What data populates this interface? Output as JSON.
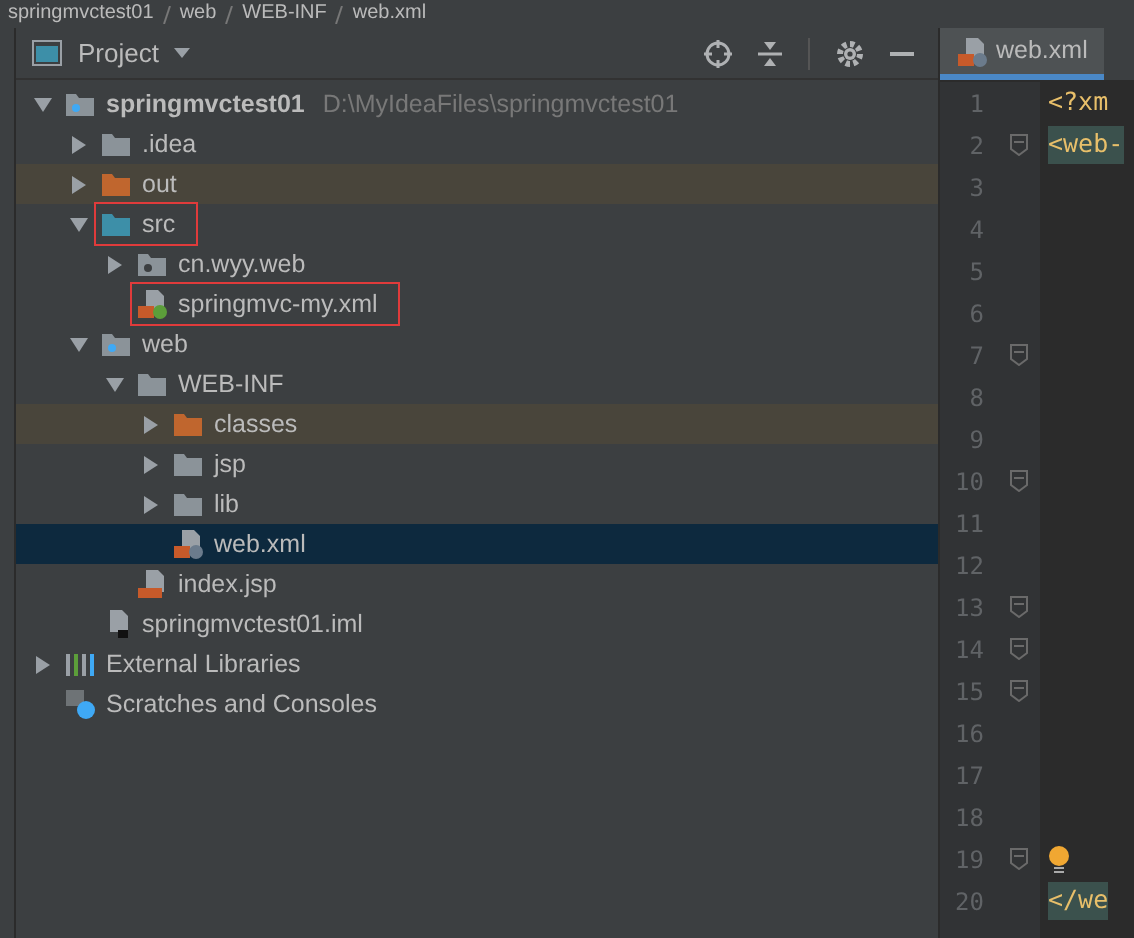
{
  "breadcrumbs": [
    "springmvctest01",
    "web",
    "WEB-INF",
    "web.xml"
  ],
  "project_panel": {
    "title": "Project"
  },
  "tree": [
    {
      "name": "springmvctest01",
      "kind": "module",
      "path": "D:\\MyIdeaFiles\\springmvctest01",
      "expanded": true,
      "selected": false,
      "excluded": false,
      "outlined": false,
      "children": [
        {
          "name": ".idea",
          "kind": "folder",
          "expanded": false,
          "selected": false,
          "excluded": false,
          "outlined": false
        },
        {
          "name": "out",
          "kind": "folder",
          "expanded": false,
          "selected": false,
          "excluded": true,
          "outlined": false
        },
        {
          "name": "src",
          "kind": "source-folder",
          "expanded": true,
          "selected": false,
          "excluded": false,
          "outlined": true,
          "children": [
            {
              "name": "cn.wyy.web",
              "kind": "package",
              "expanded": false,
              "selected": false,
              "excluded": false,
              "outlined": false
            },
            {
              "name": "springmvc-my.xml",
              "kind": "spring-xml",
              "selected": false,
              "excluded": false,
              "outlined": true
            }
          ]
        },
        {
          "name": "web",
          "kind": "web-folder",
          "expanded": true,
          "selected": false,
          "excluded": false,
          "outlined": false,
          "children": [
            {
              "name": "WEB-INF",
              "kind": "folder",
              "expanded": true,
              "selected": false,
              "excluded": false,
              "outlined": false,
              "children": [
                {
                  "name": "classes",
                  "kind": "folder",
                  "expanded": false,
                  "selected": false,
                  "excluded": true,
                  "outlined": false
                },
                {
                  "name": "jsp",
                  "kind": "folder",
                  "expanded": false,
                  "selected": false,
                  "excluded": false,
                  "outlined": false
                },
                {
                  "name": "lib",
                  "kind": "folder",
                  "expanded": false,
                  "selected": false,
                  "excluded": false,
                  "outlined": false
                },
                {
                  "name": "web.xml",
                  "kind": "web-xml",
                  "selected": true,
                  "excluded": false,
                  "outlined": false
                }
              ]
            },
            {
              "name": "index.jsp",
              "kind": "jsp",
              "selected": false,
              "excluded": false,
              "outlined": false
            }
          ]
        },
        {
          "name": "springmvctest01.iml",
          "kind": "iml",
          "selected": false,
          "excluded": false,
          "outlined": false
        }
      ]
    },
    {
      "name": "External Libraries",
      "kind": "libraries",
      "expanded": false,
      "selected": false,
      "excluded": false,
      "outlined": false
    },
    {
      "name": "Scratches and Consoles",
      "kind": "scratches",
      "selected": false,
      "excluded": false,
      "outlined": false
    }
  ],
  "editor": {
    "tab": {
      "label": "web.xml",
      "selected": true
    },
    "lines": [
      {
        "number": "1",
        "code": "<?xm",
        "fold": false,
        "bulb": false
      },
      {
        "number": "2",
        "code": "<web-",
        "fold": true,
        "bulb": false
      },
      {
        "number": "3",
        "fold": false,
        "bulb": false
      },
      {
        "number": "4",
        "fold": false,
        "bulb": false
      },
      {
        "number": "5",
        "fold": false,
        "bulb": false
      },
      {
        "number": "6",
        "fold": false,
        "bulb": false
      },
      {
        "number": "7",
        "fold": true,
        "bulb": false
      },
      {
        "number": "8",
        "fold": false,
        "bulb": false
      },
      {
        "number": "9",
        "fold": false,
        "bulb": false
      },
      {
        "number": "10",
        "fold": true,
        "bulb": false
      },
      {
        "number": "11",
        "fold": false,
        "bulb": false
      },
      {
        "number": "12",
        "fold": false,
        "bulb": false
      },
      {
        "number": "13",
        "fold": true,
        "bulb": false
      },
      {
        "number": "14",
        "fold": true,
        "bulb": false
      },
      {
        "number": "15",
        "fold": true,
        "bulb": false
      },
      {
        "number": "16",
        "fold": false,
        "bulb": false
      },
      {
        "number": "17",
        "fold": false,
        "bulb": false
      },
      {
        "number": "18",
        "fold": false,
        "bulb": false
      },
      {
        "number": "19",
        "fold": true,
        "bulb": true
      },
      {
        "number": "20",
        "code": "</we",
        "fold": false,
        "bulb": false
      }
    ]
  }
}
